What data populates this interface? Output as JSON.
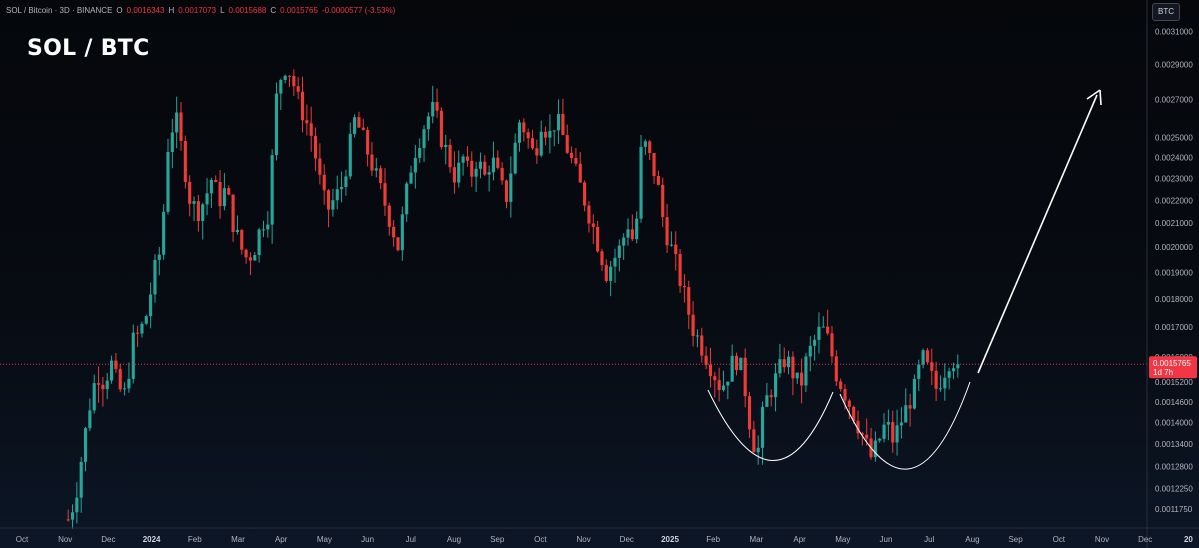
{
  "header": {
    "symbol": "SOL / Bitcoin · 3D · BINANCE",
    "o_label": "O",
    "o_value": "0.0016343",
    "h_label": "H",
    "h_value": "0.0017073",
    "l_label": "L",
    "l_value": "0.0015688",
    "c_label": "C",
    "c_value": "0.0015765",
    "change": "-0.0000577 (-3.53%)"
  },
  "title": "SOL / BTC",
  "currency_badge": "BTC",
  "colors": {
    "up": "#26a69a",
    "down": "#ef3b36",
    "price_line": "#f23645",
    "annotation": "#ffffff"
  },
  "price_label": {
    "value": "0.0015765",
    "countdown": "1d 7h"
  },
  "chart_data": {
    "type": "candlestick",
    "title": "SOL / BTC",
    "axis_scale": "log",
    "ylim": [
      0.00113,
      0.0032
    ],
    "y_ticks": [
      {
        "v": 0.0031,
        "label": "0.0031000"
      },
      {
        "v": 0.0029,
        "label": "0.0029000"
      },
      {
        "v": 0.0027,
        "label": "0.0027000"
      },
      {
        "v": 0.0025,
        "label": "0.0025000"
      },
      {
        "v": 0.0024,
        "label": "0.0024000"
      },
      {
        "v": 0.0023,
        "label": "0.0023000"
      },
      {
        "v": 0.0022,
        "label": "0.0022000"
      },
      {
        "v": 0.0021,
        "label": "0.0021000"
      },
      {
        "v": 0.002,
        "label": "0.0020000"
      },
      {
        "v": 0.0019,
        "label": "0.0019000"
      },
      {
        "v": 0.0018,
        "label": "0.0018000"
      },
      {
        "v": 0.0017,
        "label": "0.0017000"
      },
      {
        "v": 0.0016,
        "label": "0.0016000"
      },
      {
        "v": 0.00152,
        "label": "0.0015200"
      },
      {
        "v": 0.00146,
        "label": "0.0014600"
      },
      {
        "v": 0.0014,
        "label": "0.0014000"
      },
      {
        "v": 0.00134,
        "label": "0.0013400"
      },
      {
        "v": 0.00128,
        "label": "0.0012800"
      },
      {
        "v": 0.001225,
        "label": "0.0012250"
      },
      {
        "v": 0.001175,
        "label": "0.0011750"
      }
    ],
    "x_ticks": [
      {
        "label": "Oct",
        "strong": false
      },
      {
        "label": "Nov",
        "strong": false
      },
      {
        "label": "Dec",
        "strong": false
      },
      {
        "label": "2024",
        "strong": true
      },
      {
        "label": "Feb",
        "strong": false
      },
      {
        "label": "Mar",
        "strong": false
      },
      {
        "label": "Apr",
        "strong": false
      },
      {
        "label": "May",
        "strong": false
      },
      {
        "label": "Jun",
        "strong": false
      },
      {
        "label": "Jul",
        "strong": false
      },
      {
        "label": "Aug",
        "strong": false
      },
      {
        "label": "Sep",
        "strong": false
      },
      {
        "label": "Oct",
        "strong": false
      },
      {
        "label": "Nov",
        "strong": false
      },
      {
        "label": "Dec",
        "strong": false
      },
      {
        "label": "2025",
        "strong": true
      },
      {
        "label": "Feb",
        "strong": false
      },
      {
        "label": "Mar",
        "strong": false
      },
      {
        "label": "Apr",
        "strong": false
      },
      {
        "label": "May",
        "strong": false
      },
      {
        "label": "Jun",
        "strong": false
      },
      {
        "label": "Jul",
        "strong": false
      },
      {
        "label": "Aug",
        "strong": false
      },
      {
        "label": "Sep",
        "strong": false
      },
      {
        "label": "Oct",
        "strong": false
      },
      {
        "label": "Nov",
        "strong": false
      },
      {
        "label": "Dec",
        "strong": false
      },
      {
        "label": "20",
        "strong": true
      }
    ],
    "close_path": [
      0.00115,
      0.0012,
      0.00132,
      0.00145,
      0.00155,
      0.00152,
      0.00158,
      0.0015,
      0.00148,
      0.00165,
      0.00168,
      0.00175,
      0.0019,
      0.002,
      0.0025,
      0.0026,
      0.0024,
      0.0022,
      0.00215,
      0.0022,
      0.0023,
      0.0022,
      0.00225,
      0.0021,
      0.002,
      0.00195,
      0.002,
      0.0021,
      0.00215,
      0.0027,
      0.0029,
      0.00285,
      0.0027,
      0.0026,
      0.0025,
      0.0023,
      0.00215,
      0.0022,
      0.00225,
      0.0024,
      0.0026,
      0.0025,
      0.0024,
      0.0023,
      0.0022,
      0.0021,
      0.002,
      0.0022,
      0.0024,
      0.0025,
      0.0026,
      0.00265,
      0.0025,
      0.0024,
      0.0023,
      0.0024,
      0.0023,
      0.0024,
      0.0023,
      0.0024,
      0.0023,
      0.0022,
      0.0024,
      0.0026,
      0.0025,
      0.0024,
      0.0026,
      0.0025,
      0.0026,
      0.0025,
      0.0024,
      0.0023,
      0.0022,
      0.0021,
      0.002,
      0.0019,
      0.00195,
      0.002,
      0.0021,
      0.002,
      0.0025,
      0.0024,
      0.0023,
      0.0021,
      0.002,
      0.0019,
      0.0018,
      0.0017,
      0.00165,
      0.0016,
      0.00155,
      0.0015,
      0.00155,
      0.0016,
      0.00155,
      0.0014,
      0.0013,
      0.00145,
      0.0015,
      0.00155,
      0.0016,
      0.00155,
      0.0015,
      0.0016,
      0.00165,
      0.0017,
      0.00165,
      0.00155,
      0.0015,
      0.00145,
      0.0014,
      0.00135,
      0.0013,
      0.00135,
      0.0014,
      0.00135,
      0.0014,
      0.00145,
      0.0015,
      0.0016,
      0.00155,
      0.0015,
      0.00155,
      0.0016,
      0.001577
    ]
  },
  "annotations": {
    "cup_left": "cup-curve",
    "cup_right": "cup-curve",
    "arrow": "up-arrow"
  }
}
